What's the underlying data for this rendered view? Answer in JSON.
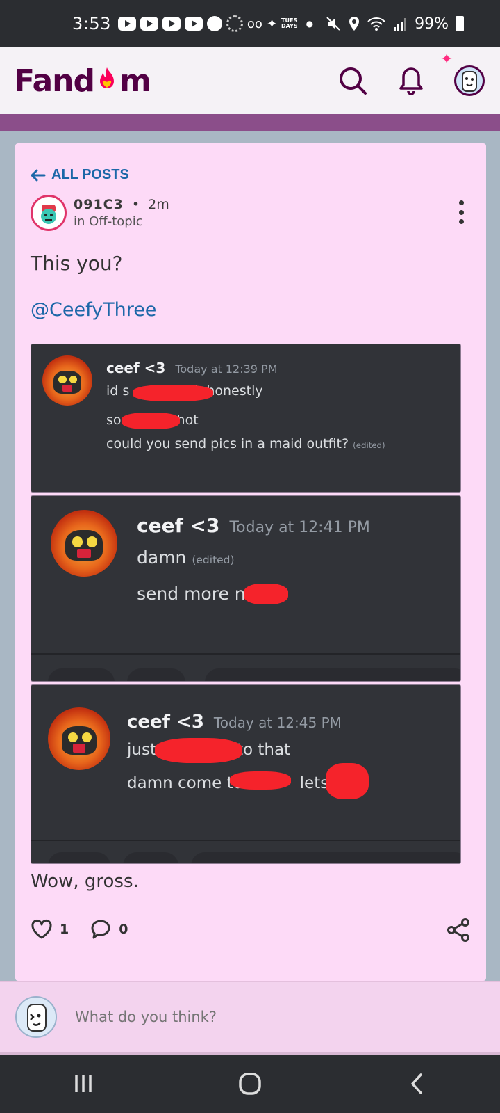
{
  "status_bar": {
    "time": "3:53",
    "tues_line1": "TUES",
    "tues_line2": "DAYS",
    "battery": "99%",
    "icons": [
      "youtube-icon",
      "youtube-icon",
      "youtube-icon",
      "youtube-icon",
      "pinterest-icon",
      "loading-ring-icon",
      "voicemail-icon",
      "bird-icon",
      "tuesdays-icon",
      "dot-icon",
      "mute-icon",
      "location-icon",
      "wifi-icon",
      "signal-icon",
      "battery-icon"
    ]
  },
  "header": {
    "logo_text_left": "Fand",
    "logo_text_right": "m",
    "icons": [
      "search-icon",
      "bell-icon",
      "profile-avatar",
      "sparkle-icon"
    ]
  },
  "post": {
    "back_label": "ALL POSTS",
    "author": "091C3",
    "separator": "•",
    "time_ago": "2m",
    "community": "in Off-topic",
    "title": "This you?",
    "mention": "@CeefyThree",
    "closing": "Wow, gross.",
    "likes": "1",
    "comments": "0"
  },
  "screenshots": [
    {
      "name": "ceef <3",
      "time": "Today at 12:39 PM",
      "lines": [
        {
          "a": "id s",
          "b": "k honestly"
        },
        {
          "a": "so",
          "b": "hot"
        },
        {
          "a": "could you send pics in a maid outfit?",
          "edited": "(edited)"
        }
      ]
    },
    {
      "name": "ceef <3",
      "time": "Today at 12:41 PM",
      "lines": [
        {
          "a": "damn",
          "edited": "(edited)"
        },
        {
          "a": "send more n"
        }
      ]
    },
    {
      "name": "ceef <3",
      "time": "Today at 12:45 PM",
      "lines": [
        {
          "a": "just",
          "b": "to that"
        },
        {
          "a": "damn come to",
          "b": "lets"
        }
      ]
    }
  ],
  "comment_bar": {
    "placeholder": "What do you think?"
  },
  "nav": {
    "icons": [
      "recent-apps-icon",
      "home-icon",
      "back-icon"
    ]
  },
  "colors": {
    "brand": "#520044",
    "link": "#1c67a8",
    "card_bg": "#fddaf7",
    "discord_bg": "#313338",
    "redaction": "#f5232b"
  }
}
